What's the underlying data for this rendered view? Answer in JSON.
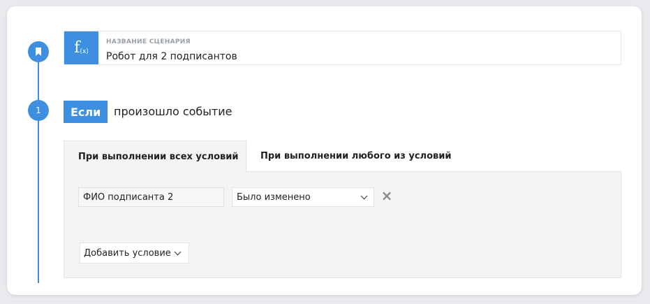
{
  "scenario": {
    "label": "НАЗВАНИЕ СЦЕНАРИЯ",
    "name": "Робот для 2 подписантов",
    "fx_main": "f",
    "fx_sub": "(x)"
  },
  "step": {
    "number": "1",
    "if_label": "Если",
    "title": "произошло событие"
  },
  "tabs": [
    {
      "label": "При выполнении всех условий",
      "active": true
    },
    {
      "label": "При выполнении любого из условий",
      "active": false
    }
  ],
  "condition": {
    "field": "ФИО подписанта 2",
    "operator": "Было изменено",
    "remove_icon": "×"
  },
  "add_condition_label": "Добавить условие",
  "colors": {
    "accent": "#3f8fe0",
    "panel": "#f4f4f4"
  },
  "icons": {
    "timeline_top": "bookmark-icon",
    "remove": "close-icon",
    "dropdown": "chevron-down-icon"
  }
}
